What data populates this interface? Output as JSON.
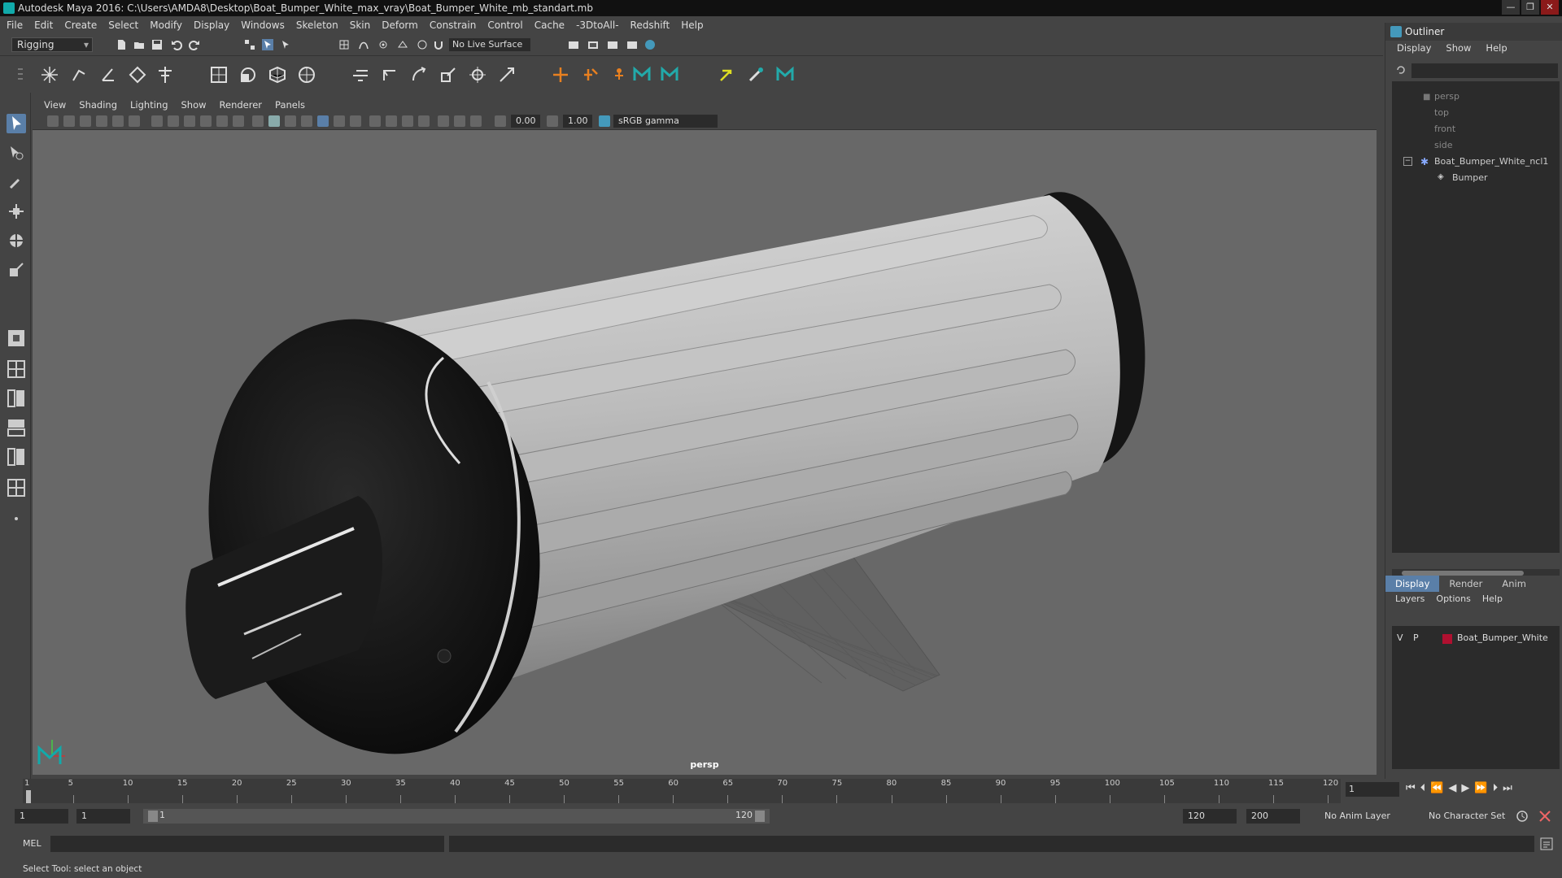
{
  "window": {
    "title": "Autodesk Maya 2016: C:\\Users\\AMDA8\\Desktop\\Boat_Bumper_White_max_vray\\Boat_Bumper_White_mb_standart.mb"
  },
  "menubar": [
    "File",
    "Edit",
    "Create",
    "Select",
    "Modify",
    "Display",
    "Windows",
    "Skeleton",
    "Skin",
    "Deform",
    "Constrain",
    "Control",
    "Cache",
    "-3DtoAll-",
    "Redshift",
    "Help"
  ],
  "status_line": {
    "mode": "Rigging",
    "live_surface": "No Live Surface"
  },
  "panel_menu": [
    "View",
    "Shading",
    "Lighting",
    "Show",
    "Renderer",
    "Panels"
  ],
  "panel_toolbar": {
    "exposure": "0.00",
    "gamma": "1.00",
    "color_space": "sRGB gamma"
  },
  "viewport": {
    "camera_label": "persp"
  },
  "outliner": {
    "title": "Outliner",
    "menu": [
      "Display",
      "Show",
      "Help"
    ],
    "items": [
      "persp",
      "top",
      "front",
      "side",
      "Boat_Bumper_White_ncl1",
      "Bumper"
    ]
  },
  "layer_editor": {
    "tabs": [
      "Display",
      "Render",
      "Anim"
    ],
    "menu": [
      "Layers",
      "Options",
      "Help"
    ],
    "layer": {
      "v": "V",
      "p": "P",
      "name": "Boat_Bumper_White",
      "color": "#b01030"
    }
  },
  "timeline": {
    "ticks": [
      "1",
      "5",
      "10",
      "15",
      "20",
      "25",
      "30",
      "35",
      "40",
      "45",
      "50",
      "55",
      "60",
      "65",
      "70",
      "75",
      "80",
      "85",
      "90",
      "95",
      "100",
      "105",
      "110",
      "115",
      "120"
    ],
    "current_frame": "1"
  },
  "range": {
    "start": "1",
    "playback_start": "1",
    "slider_start": "1",
    "slider_end": "120",
    "playback_end": "120",
    "end": "200",
    "anim_layer": "No Anim Layer",
    "character_set": "No Character Set"
  },
  "command_line": {
    "label": "MEL"
  },
  "help_line": "Select Tool: select an object",
  "colors": {
    "accent": "#5a7fa8",
    "viewport_bg": "#686868",
    "panel_bg": "#444444"
  }
}
